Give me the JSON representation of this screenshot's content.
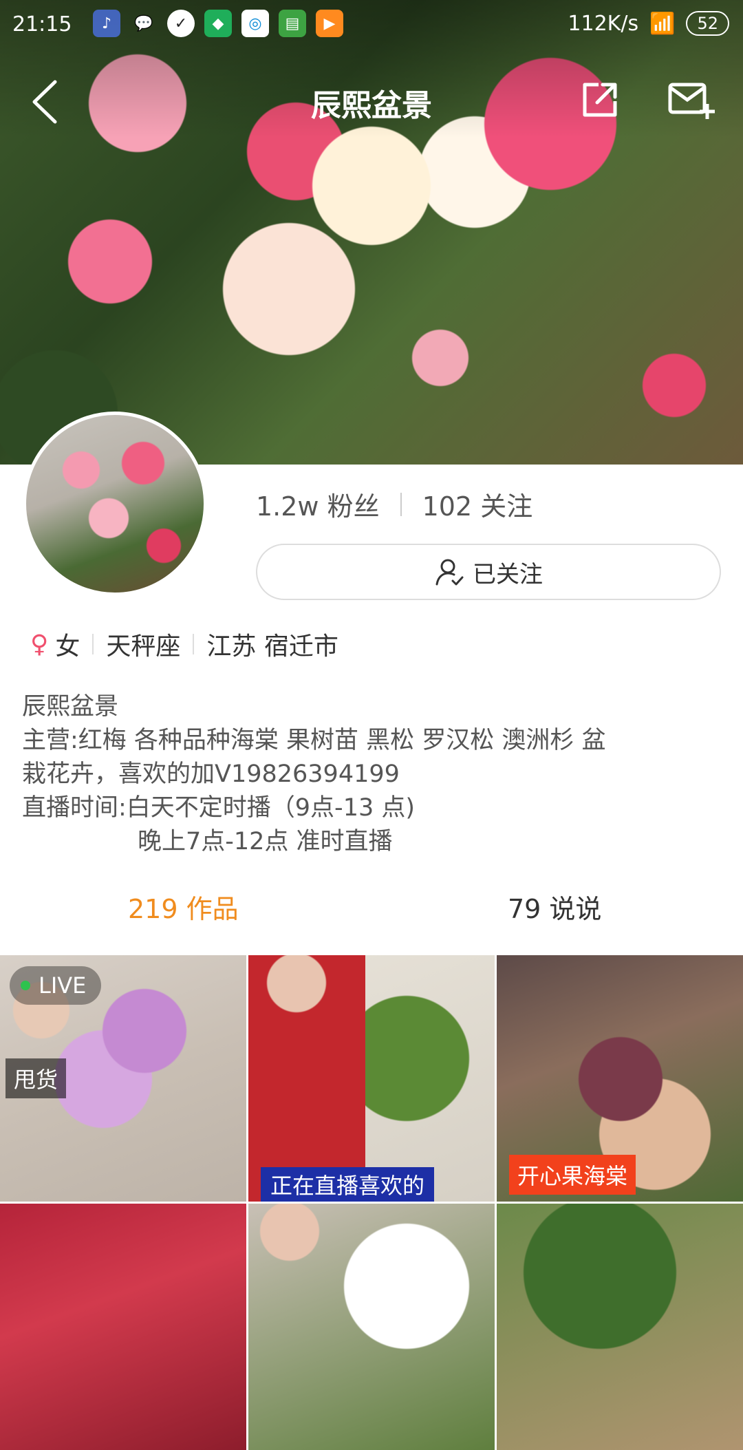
{
  "status_bar": {
    "time": "21:15",
    "network_speed": "112K/s",
    "battery": "52"
  },
  "nav": {
    "title": "辰熙盆景"
  },
  "profile": {
    "fans": "1.2w 粉丝",
    "following": "102 关注",
    "follow_button": "已关注",
    "gender": "女",
    "zodiac": "天秤座",
    "location": "江苏 宿迁市"
  },
  "bio": {
    "line1": "辰熙盆景",
    "line2": "主营:红梅  各种品种海棠 果树苗 黑松 罗汉松  澳洲杉 盆",
    "line3": "栽花卉，喜欢的加V19826394199",
    "line4": "直播时间:白天不定时播（9点-13 点)",
    "line5": "晚上7点-12点    准时直播"
  },
  "tabs": {
    "works": "219 作品",
    "says": "79 说说"
  },
  "grid": {
    "live_label": "LIVE",
    "shuai_label": "甩货",
    "caption_2": "正在直播喜欢的",
    "caption_3": "开心果海棠"
  },
  "colors": {
    "accent": "#f08c1e",
    "live_dot": "#2ec24e"
  }
}
